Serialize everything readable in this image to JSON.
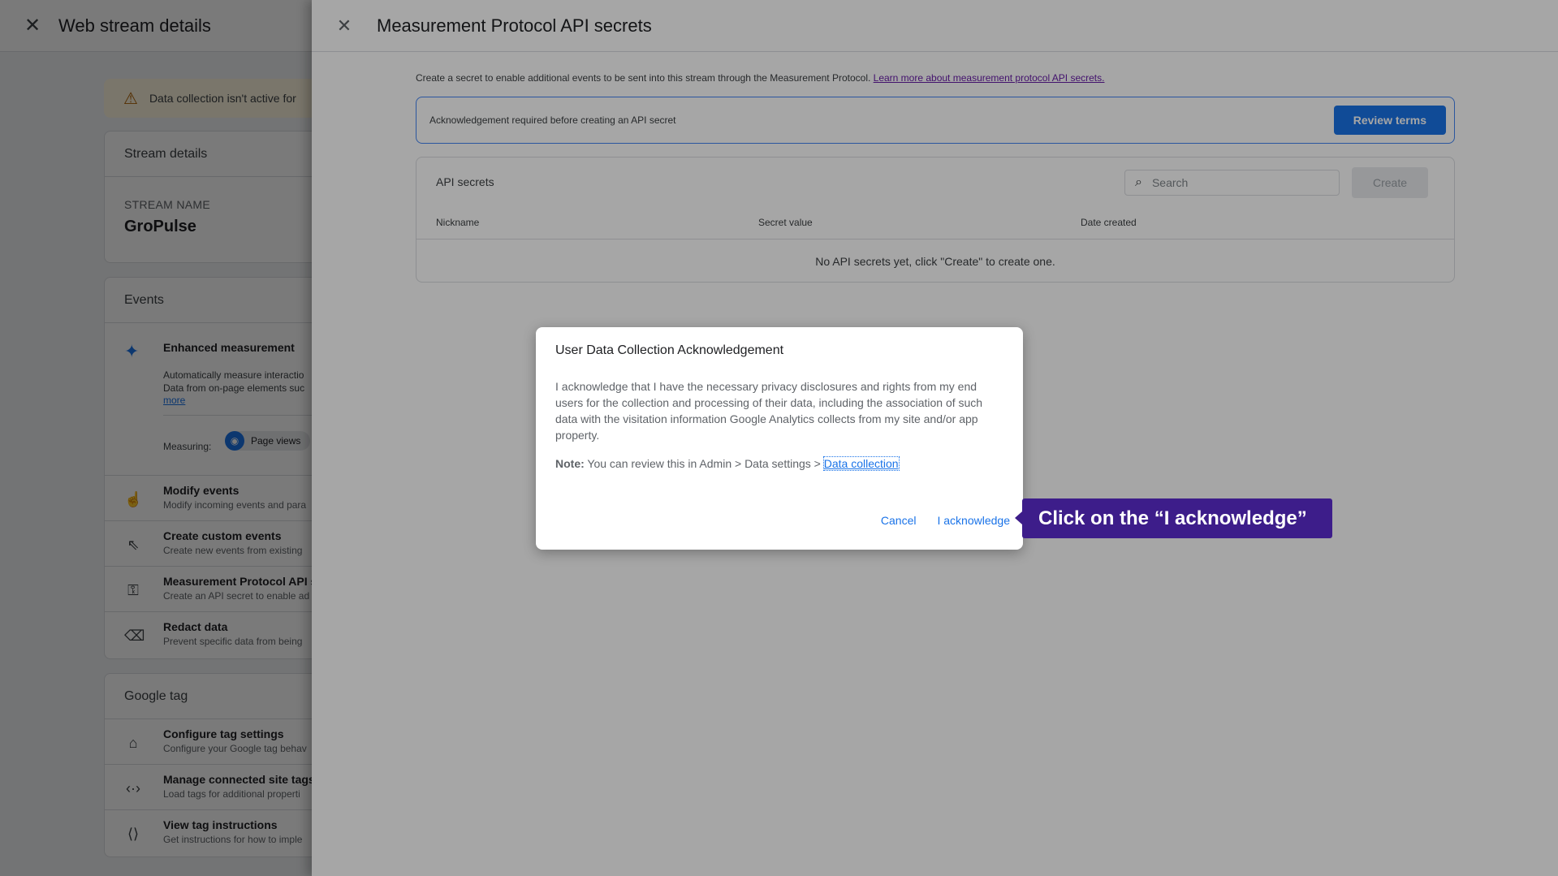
{
  "left_panel": {
    "title": "Web stream details",
    "warning": "Data collection isn't active for",
    "stream_details": {
      "heading": "Stream details",
      "stream_name_label": "STREAM NAME",
      "stream_name_value": "GroPulse"
    },
    "events": {
      "heading": "Events",
      "enhanced_measurement": {
        "title": "Enhanced measurement",
        "desc1": "Automatically measure interactio",
        "desc2": "Data from on-page elements suc",
        "more_link": "more",
        "measuring_label": "Measuring:",
        "chip_label": "Page views"
      },
      "items": [
        {
          "icon": "touch-icon",
          "glyph": "☝",
          "title": "Modify events",
          "desc": "Modify incoming events and para"
        },
        {
          "icon": "cursor-click-icon",
          "glyph": "⇖",
          "title": "Create custom events",
          "desc": "Create new events from existing"
        },
        {
          "icon": "key-icon",
          "glyph": "⚿",
          "title": "Measurement Protocol API s",
          "desc": "Create an API secret to enable ad"
        },
        {
          "icon": "eraser-icon",
          "glyph": "⌫",
          "title": "Redact data",
          "desc": "Prevent specific data from being"
        }
      ]
    },
    "google_tag": {
      "heading": "Google tag",
      "items": [
        {
          "icon": "tag-icon",
          "glyph": "🏷",
          "title": "Configure tag settings",
          "desc": "Configure your Google tag behav"
        },
        {
          "icon": "code-arrows-icon",
          "glyph": "‹·›",
          "title": "Manage connected site tags",
          "desc": "Load tags for additional properti"
        },
        {
          "icon": "clipboard-code-icon",
          "glyph": "⟨⟩",
          "title": "View tag instructions",
          "desc": "Get instructions for how to imple"
        }
      ]
    }
  },
  "right_panel": {
    "title": "Measurement Protocol API secrets",
    "intro_text": "Create a secret to enable additional events to be sent into this stream through the Measurement Protocol. ",
    "intro_link": "Learn more about measurement protocol API secrets.",
    "ack_banner": {
      "message": "Acknowledgement required before creating an API secret",
      "button": "Review terms"
    },
    "api_secrets": {
      "heading": "API secrets",
      "search_placeholder": "Search",
      "create_button": "Create",
      "columns": [
        "Nickname",
        "Secret value",
        "Date created"
      ],
      "empty_message": "No API secrets yet, click \"Create\" to create one."
    }
  },
  "dialog": {
    "title": "User Data Collection Acknowledgement",
    "body": "I acknowledge that I have the necessary privacy disclosures and rights from my end users for the collection and processing of their data, including the association of such data with the visitation information Google Analytics collects from my site and/or app property.",
    "note_label": "Note:",
    "note_text": " You can review this in Admin > Data settings > ",
    "note_link": "Data collection",
    "cancel": "Cancel",
    "confirm": "I acknowledge"
  },
  "tooltip": {
    "text": "Click on the “I acknowledge”"
  },
  "colors": {
    "accent": "#1a73e8",
    "tooltip_bg": "#3d1d8a",
    "link_visited": "#681da8"
  }
}
